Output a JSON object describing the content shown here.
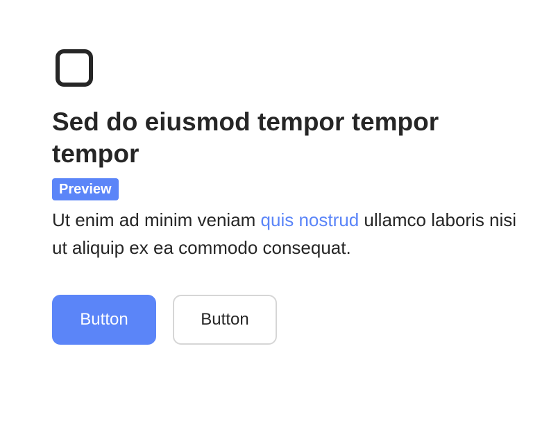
{
  "card": {
    "icon": "rounded-square-icon",
    "title": "Sed do eiusmod tempor tempor tempor",
    "badge": "Preview",
    "description": {
      "before_link": "Ut enim ad minim veniam ",
      "link": "quis nostrud",
      "after_link": " ullamco laboris nisi ut aliquip ex ea commodo consequat."
    },
    "buttons": {
      "primary_label": "Button",
      "secondary_label": "Button"
    }
  },
  "colors": {
    "accent": "#5b85f8",
    "text": "#262626",
    "secondary_border": "#d6d6d6"
  }
}
